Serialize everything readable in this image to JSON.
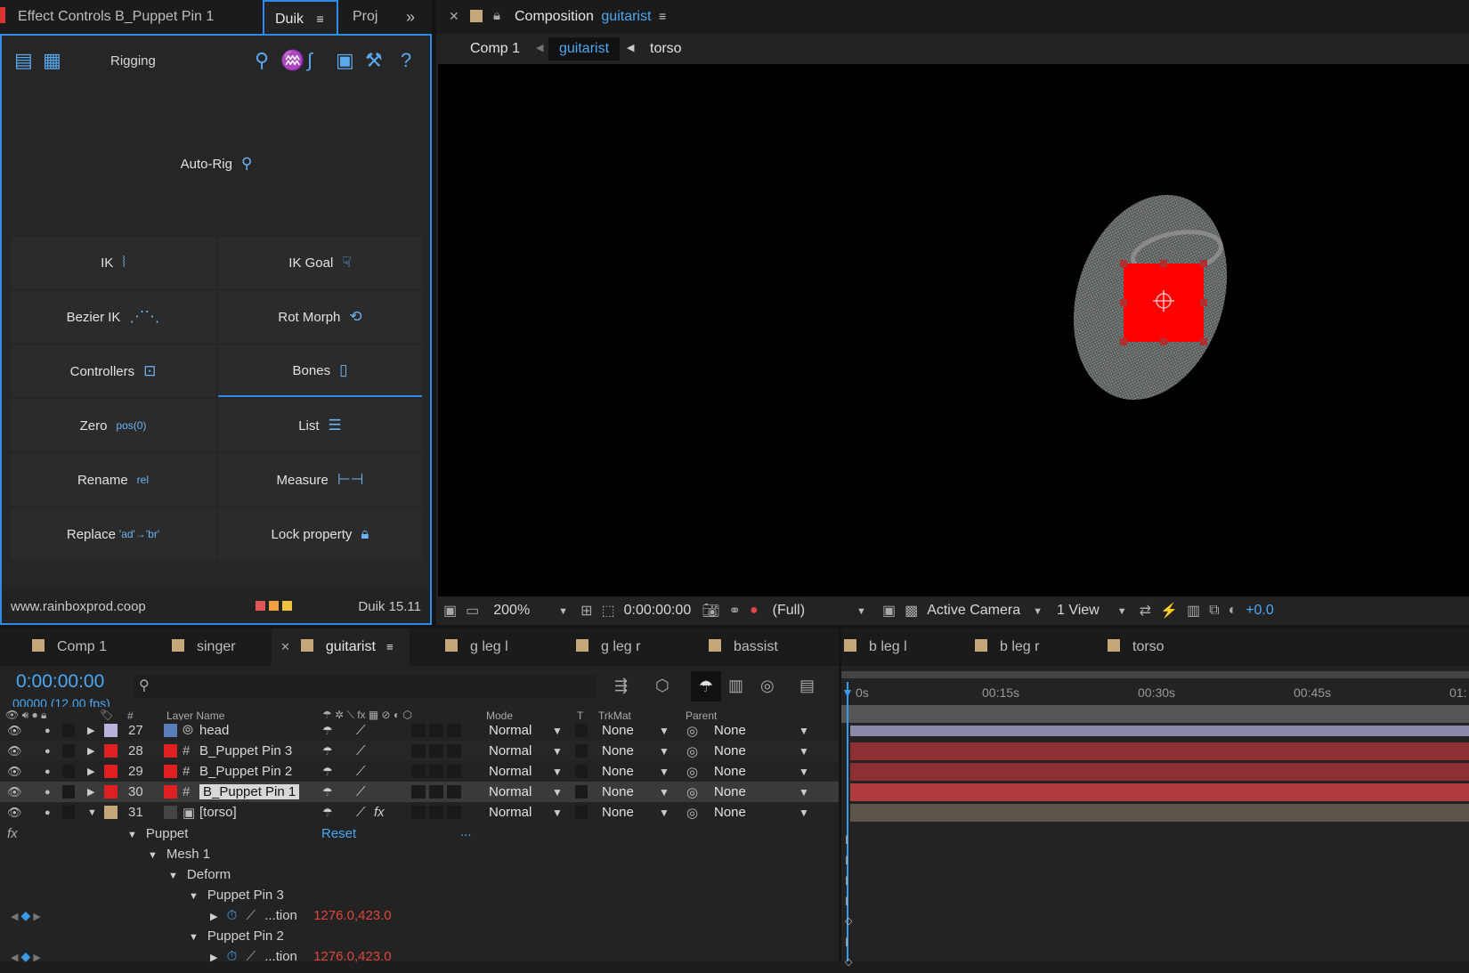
{
  "duik_panel": {
    "tabs": [
      "Effect Controls B_Puppet Pin 1",
      "Duik",
      "Proj"
    ],
    "section": "Rigging",
    "autorig": "Auto-Rig",
    "tools": [
      {
        "label": "IK"
      },
      {
        "label": "IK Goal"
      },
      {
        "label": "Bezier IK"
      },
      {
        "label": "Rot Morph"
      },
      {
        "label": "Controllers"
      },
      {
        "label": "Bones"
      },
      {
        "label": "Zero",
        "badge": "pos(0)"
      },
      {
        "label": "List"
      },
      {
        "label": "Rename",
        "badge": "rel"
      },
      {
        "label": "Measure"
      },
      {
        "label": "Replace",
        "badge": "'ad'→'br'"
      },
      {
        "label": "Lock property"
      }
    ],
    "footer_url": "www.rainboxprod.coop",
    "version": "Duik 15.11"
  },
  "composition": {
    "label": "Composition",
    "name": "guitarist",
    "breadcrumb": [
      "Comp 1",
      "guitarist",
      "torso"
    ],
    "zoom": "200%",
    "timecode": "0:00:00:00",
    "resolution": "(Full)",
    "camera": "Active Camera",
    "views": "1 View",
    "exposure": "+0.0"
  },
  "timeline": {
    "tabs": [
      "Comp 1",
      "singer",
      "guitarist",
      "g leg l",
      "g leg r",
      "bassist",
      "b leg l",
      "b leg r",
      "torso"
    ],
    "active_tab": "guitarist",
    "current_time": "0:00:00:00",
    "frames_fps": "00000 (12.00 fps)",
    "ruler": [
      "0s",
      "00:15s",
      "00:30s",
      "00:45s",
      "01:"
    ],
    "headers": {
      "num": "#",
      "layer_name": "Layer Name",
      "mode": "Mode",
      "t": "T",
      "trkmat": "TrkMat",
      "parent": "Parent"
    },
    "layers": [
      {
        "num": "27",
        "name": "head",
        "mode": "Normal",
        "trkmat": "None",
        "parent": "None",
        "color": "#b7b3dc"
      },
      {
        "num": "28",
        "name": "B_Puppet Pin 3",
        "mode": "Normal",
        "trkmat": "None",
        "parent": "None",
        "color": "#e02020"
      },
      {
        "num": "29",
        "name": "B_Puppet Pin 2",
        "mode": "Normal",
        "trkmat": "None",
        "parent": "None",
        "color": "#e02020"
      },
      {
        "num": "30",
        "name": "B_Puppet Pin 1",
        "mode": "Normal",
        "trkmat": "None",
        "parent": "None",
        "color": "#e02020"
      },
      {
        "num": "31",
        "name": "[torso]",
        "mode": "Normal",
        "trkmat": "None",
        "parent": "None",
        "color": "#c6a77a"
      }
    ],
    "props": {
      "fx": "fx",
      "puppet": "Puppet",
      "reset": "Reset",
      "dots": "...",
      "mesh": "Mesh 1",
      "deform": "Deform",
      "pin3": "Puppet Pin 3",
      "pin3_prop": "...tion",
      "pin3_val": "1276.0,423.0",
      "pin2": "Puppet Pin 2",
      "pin2_prop": "...tion",
      "pin2_val": "1276.0,423.0"
    }
  }
}
